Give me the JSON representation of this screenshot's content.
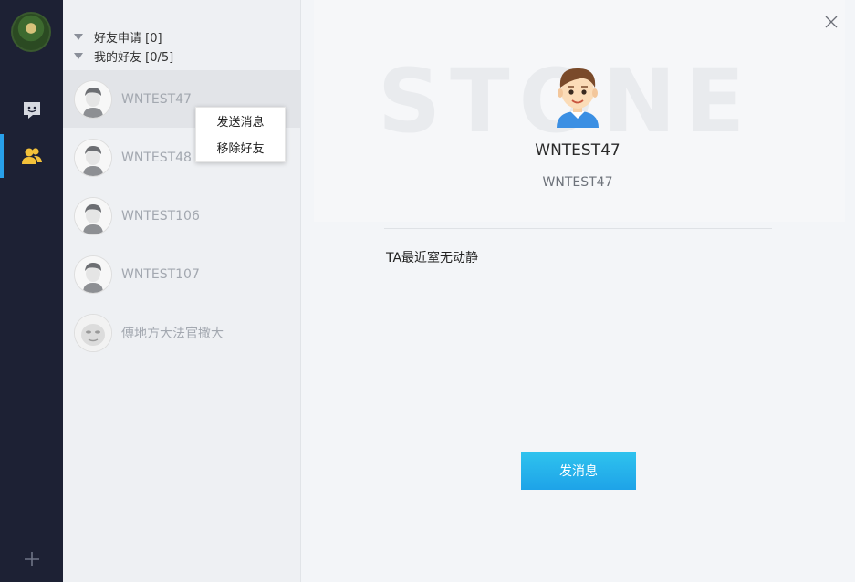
{
  "rail": {
    "nav": [
      {
        "icon": "chat-icon",
        "active": false
      },
      {
        "icon": "friends-icon",
        "active": true
      }
    ],
    "add_icon": "plus-icon",
    "accent": "#28a0ea"
  },
  "groups": {
    "requests_label": "好友申请 [0]",
    "friends_label": "我的好友 [0/5]"
  },
  "friends": [
    {
      "name": "WNTEST47"
    },
    {
      "name": "WNTEST48"
    },
    {
      "name": "WNTEST106"
    },
    {
      "name": "WNTEST107"
    },
    {
      "name": "傅地方大法官撒大"
    }
  ],
  "context_menu": {
    "send_message": "发送消息",
    "remove_friend": "移除好友"
  },
  "profile": {
    "banner_word": "STONE",
    "name": "WNTEST47",
    "id": "WNTEST47",
    "status": "TA最近窒无动静",
    "send_button": "发消息"
  }
}
